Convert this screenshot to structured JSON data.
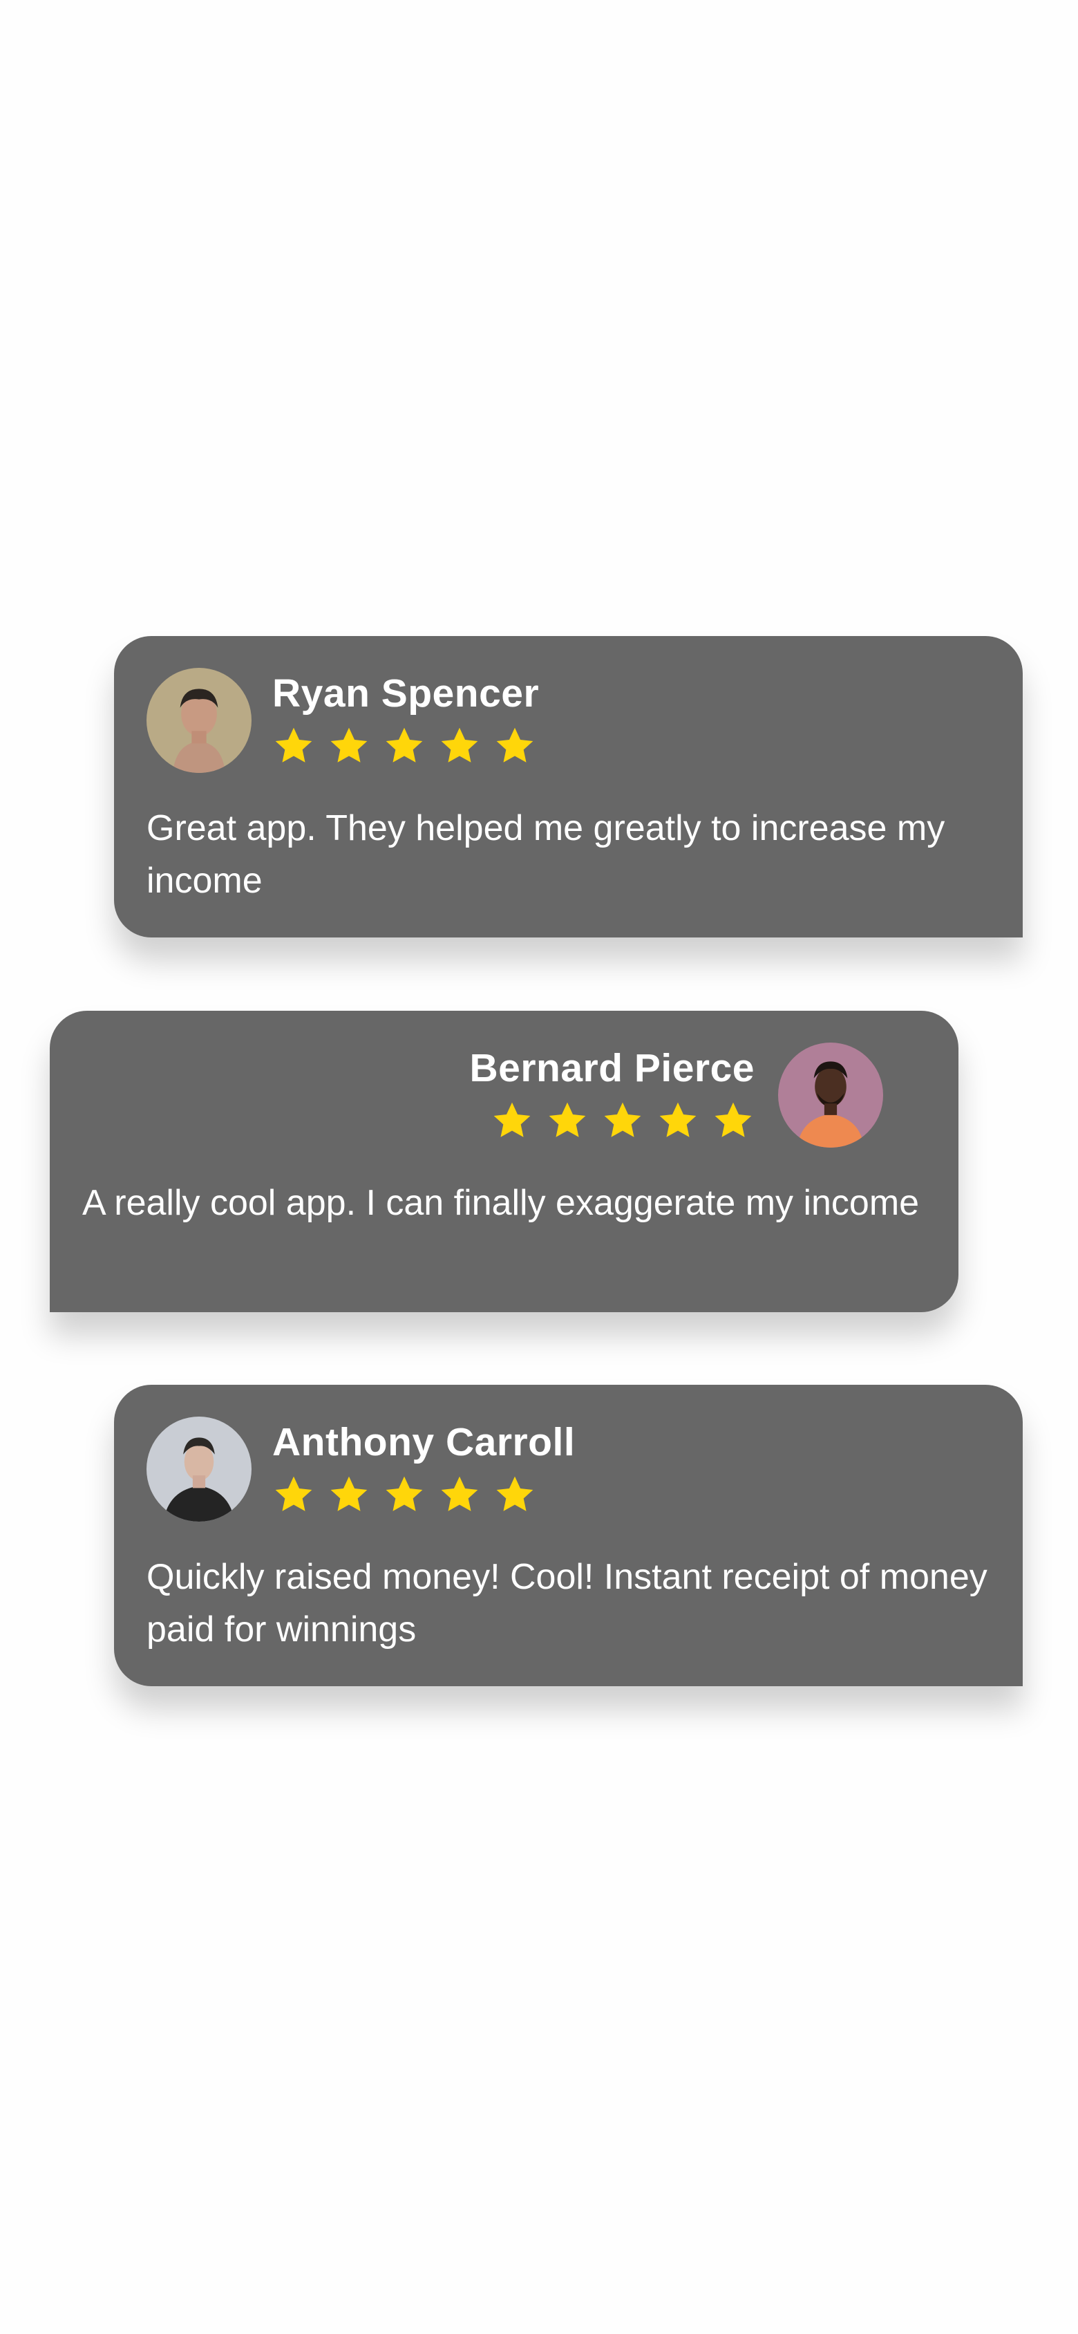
{
  "colors": {
    "background": "#fefefe",
    "card": "#676767",
    "text": "#ffffff",
    "star": "#ffd60a"
  },
  "reviews": [
    {
      "name": "Ryan Spencer",
      "rating": 5,
      "text": "Great app. They helped me greatly to increase my income",
      "avatar_icon": "user-avatar-icon"
    },
    {
      "name": "Bernard Pierce",
      "rating": 5,
      "text": "A really cool app. I can finally exaggerate my income",
      "avatar_icon": "user-avatar-icon"
    },
    {
      "name": "Anthony Carroll",
      "rating": 5,
      "text": "Quickly raised money! Cool! Instant receipt of money paid for winnings",
      "avatar_icon": "user-avatar-icon"
    }
  ]
}
